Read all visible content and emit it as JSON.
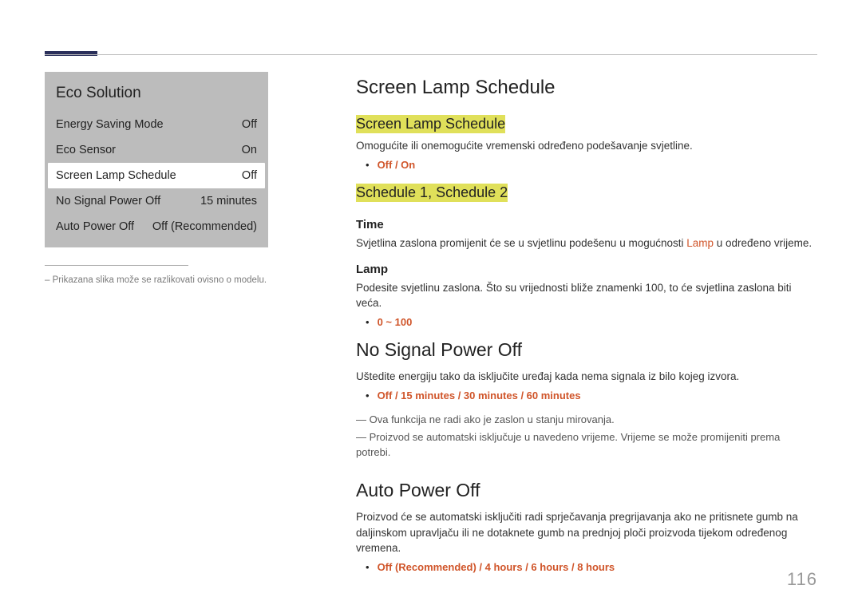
{
  "page_number": "116",
  "left": {
    "menu_title": "Eco Solution",
    "rows": [
      {
        "label": "Energy Saving Mode",
        "value": "Off"
      },
      {
        "label": "Eco Sensor",
        "value": "On"
      },
      {
        "label": "Screen Lamp Schedule",
        "value": "Off"
      },
      {
        "label": "No Signal Power Off",
        "value": "15 minutes"
      },
      {
        "label": "Auto Power Off",
        "value": "Off (Recommended)"
      }
    ],
    "footnote": "– Prikazana slika može se razlikovati ovisno o modelu."
  },
  "sections": {
    "sls": {
      "h1": "Screen Lamp Schedule",
      "h2a": "Screen Lamp Schedule",
      "desc_a": "Omogućite ili onemogućite vremenski određeno podešavanje svjetline.",
      "opt_a": "Off / On",
      "h2b": "Schedule 1, Schedule 2",
      "time_h": "Time",
      "time_p_pre": "Svjetlina zaslona promijenit će se u svjetlinu podešenu u mogućnosti ",
      "time_p_lamp": "Lamp",
      "time_p_post": " u određeno vrijeme.",
      "lamp_h": "Lamp",
      "lamp_p": "Podesite svjetlinu zaslona. Što su vrijednosti bliže znamenki 100, to će svjetlina zaslona biti veća.",
      "lamp_opt": "0 ~ 100"
    },
    "nspo": {
      "h1": "No Signal Power Off",
      "desc": "Uštedite energiju tako da isključite uređaj kada nema signala iz bilo kojeg izvora.",
      "opts": "Off / 15 minutes / 30 minutes / 60 minutes",
      "note1": "― Ova funkcija ne radi ako je zaslon u stanju mirovanja.",
      "note2": "― Proizvod se automatski isključuje u navedeno vrijeme. Vrijeme se može promijeniti prema potrebi."
    },
    "apo": {
      "h1": "Auto Power Off",
      "desc": "Proizvod će se automatski isključiti radi sprječavanja pregrijavanja ako ne pritisnete gumb na daljinskom upravljaču ili ne dotaknete gumb na prednjoj ploči proizvoda tijekom određenog vremena.",
      "opts": "Off (Recommended) / 4 hours / 6 hours / 8 hours"
    }
  }
}
